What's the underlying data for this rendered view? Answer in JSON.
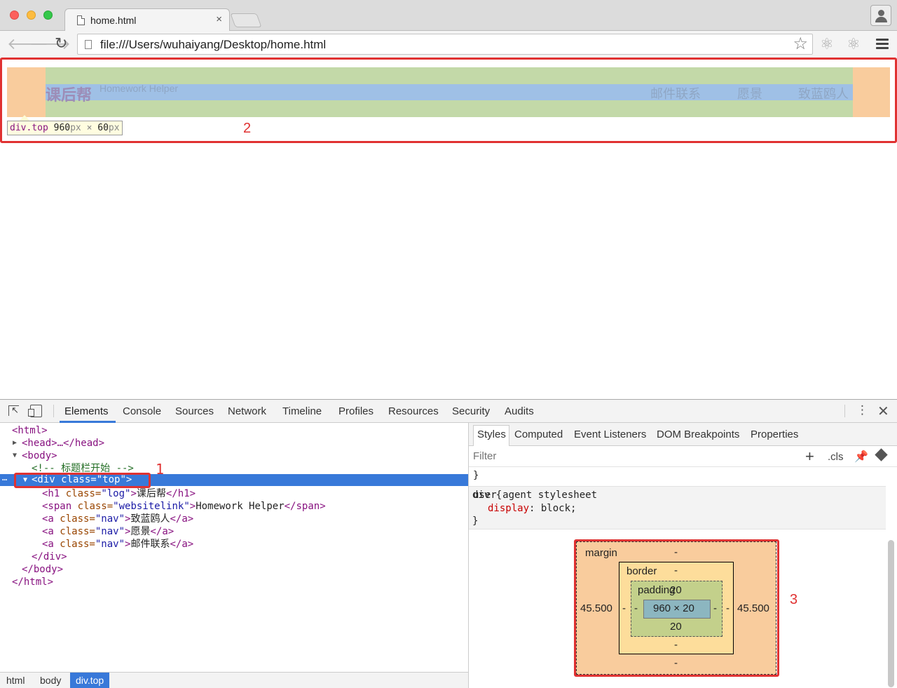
{
  "browser": {
    "tab_title": "home.html",
    "tab_close": "×",
    "url": "file:///Users/wuhaiyang/Desktop/home.html"
  },
  "page": {
    "logo": "课后帮",
    "websitelink": "Homework Helper",
    "nav": [
      "邮件联系",
      "愿景",
      "致蓝鸥人"
    ],
    "tooltip": {
      "tag": "div.top",
      "width": "960",
      "unit": "px",
      "times": "×",
      "height": "60"
    }
  },
  "annotations": {
    "one": "1",
    "two": "2",
    "three": "3"
  },
  "devtools": {
    "tabs": [
      "Elements",
      "Console",
      "Sources",
      "Network",
      "Timeline",
      "Profiles",
      "Resources",
      "Security",
      "Audits"
    ],
    "active_tab": "Elements",
    "dom": {
      "html_open": "<html>",
      "head": "<head>…</head>",
      "body_open": "<body>",
      "comment": "<!-- 标题栏开始 -->",
      "div_open_tag": "<div",
      "div_attr": " class=",
      "div_val": "\"top\"",
      "div_close_bracket": ">",
      "h1": {
        "open": "<h1",
        "attr": " class=",
        "val": "\"log\"",
        "gt": ">",
        "text": "课后帮",
        "close": "</h1>"
      },
      "span": {
        "open": "<span",
        "attr": " class=",
        "val": "\"websitelink\"",
        "gt": ">",
        "text": "Homework Helper",
        "close": "</span>"
      },
      "links": [
        {
          "open": "<a",
          "attr": " class=",
          "val": "\"nav\"",
          "gt": ">",
          "text": "致蓝鸥人",
          "close": "</a>"
        },
        {
          "open": "<a",
          "attr": " class=",
          "val": "\"nav\"",
          "gt": ">",
          "text": "愿景",
          "close": "</a>"
        },
        {
          "open": "<a",
          "attr": " class=",
          "val": "\"nav\"",
          "gt": ">",
          "text": "邮件联系",
          "close": "</a>"
        }
      ],
      "div_close": "</div>",
      "body_close": "</body>",
      "html_close": "</html>",
      "selected_dots": "…"
    },
    "breadcrumbs": [
      "html",
      "body",
      "div.top"
    ],
    "styles": {
      "tabs": [
        "Styles",
        "Computed",
        "Event Listeners",
        "DOM Breakpoints",
        "Properties"
      ],
      "filter_placeholder": "Filter",
      "plus": "+",
      "cls": ".cls",
      "close_brace": "}",
      "rule_selector": "div {",
      "rule_source": "user agent stylesheet",
      "rule_prop": "display",
      "rule_value": ": block;",
      "rule_end": "}"
    },
    "box_model": {
      "margin_label": "margin",
      "margin_top": "-",
      "margin_bottom": "-",
      "margin_left": "45.500",
      "margin_right": "45.500",
      "border_label": "border",
      "border_top": "-",
      "border_bottom": "-",
      "border_left": "-",
      "border_right": "-",
      "padding_label": "padding",
      "padding_top": "20",
      "padding_bottom": "20",
      "padding_left": "-",
      "padding_right": "-",
      "content": "960 × 20"
    }
  },
  "colors": {
    "accent": "#3879d9",
    "annotation_red": "#e03232",
    "margin": "#f9cc9d",
    "padding": "#c3d9a8",
    "content": "#9fc0e6"
  }
}
